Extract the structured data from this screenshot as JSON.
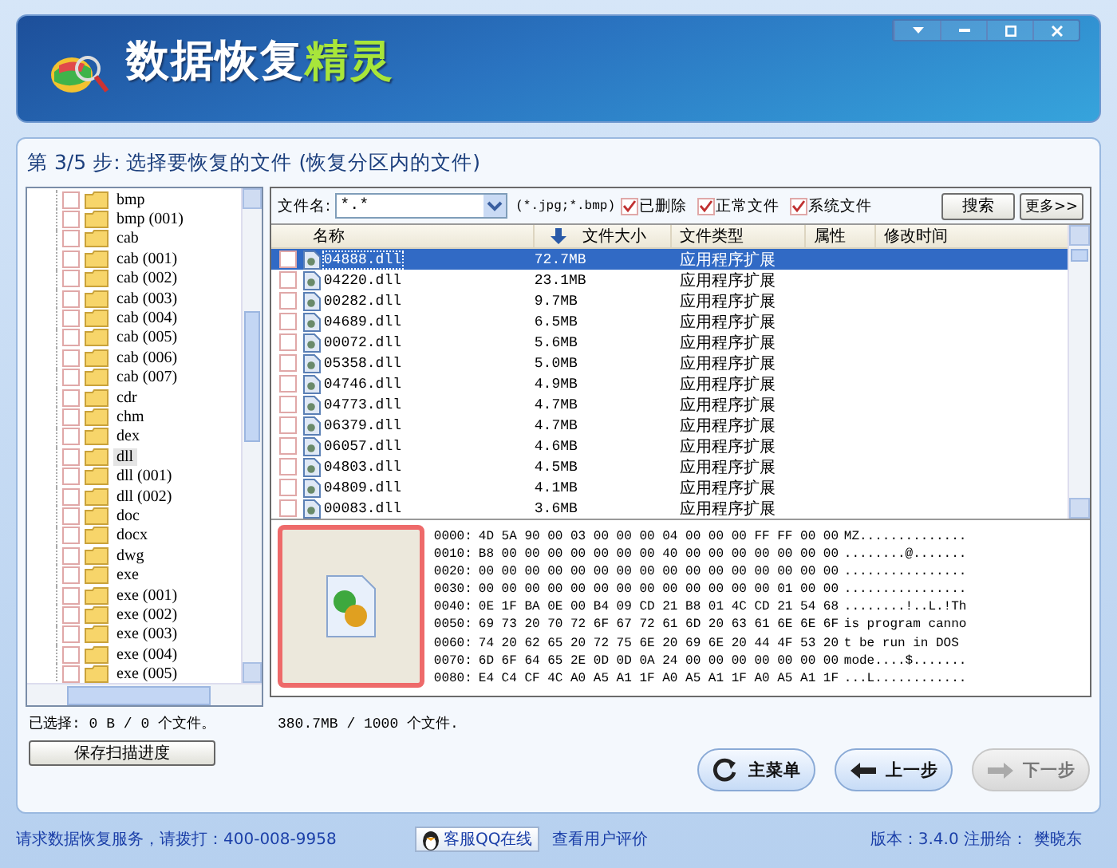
{
  "window": {
    "title_parts": [
      {
        "text": "数据恢复",
        "kind": "plain"
      },
      {
        "text": "精灵",
        "kind": "accent"
      }
    ]
  },
  "step_title": "第 3/5 步: 选择要恢复的文件 (恢复分区内的文件)",
  "tree": {
    "items": [
      {
        "label": "bmp",
        "checked": false,
        "selected": false
      },
      {
        "label": "bmp (001)",
        "checked": false,
        "selected": false
      },
      {
        "label": "cab",
        "checked": false,
        "selected": false
      },
      {
        "label": "cab (001)",
        "checked": false,
        "selected": false
      },
      {
        "label": "cab (002)",
        "checked": false,
        "selected": false
      },
      {
        "label": "cab (003)",
        "checked": false,
        "selected": false
      },
      {
        "label": "cab (004)",
        "checked": false,
        "selected": false
      },
      {
        "label": "cab (005)",
        "checked": false,
        "selected": false
      },
      {
        "label": "cab (006)",
        "checked": false,
        "selected": false
      },
      {
        "label": "cab (007)",
        "checked": false,
        "selected": false
      },
      {
        "label": "cdr",
        "checked": false,
        "selected": false
      },
      {
        "label": "chm",
        "checked": false,
        "selected": false
      },
      {
        "label": "dex",
        "checked": false,
        "selected": false
      },
      {
        "label": "dll",
        "checked": false,
        "selected": true
      },
      {
        "label": "dll (001)",
        "checked": false,
        "selected": false
      },
      {
        "label": "dll (002)",
        "checked": false,
        "selected": false
      },
      {
        "label": "doc",
        "checked": false,
        "selected": false
      },
      {
        "label": "docx",
        "checked": false,
        "selected": false
      },
      {
        "label": "dwg",
        "checked": false,
        "selected": false
      },
      {
        "label": "exe",
        "checked": false,
        "selected": false
      },
      {
        "label": "exe (001)",
        "checked": false,
        "selected": false
      },
      {
        "label": "exe (002)",
        "checked": false,
        "selected": false
      },
      {
        "label": "exe (003)",
        "checked": false,
        "selected": false
      },
      {
        "label": "exe (004)",
        "checked": false,
        "selected": false
      },
      {
        "label": "exe (005)",
        "checked": false,
        "selected": false
      }
    ]
  },
  "filter": {
    "label": "文件名:",
    "value": "*.*",
    "hint": "(*.jpg;*.bmp)",
    "options": [
      {
        "label": "已删除",
        "checked": true
      },
      {
        "label": "正常文件",
        "checked": true
      },
      {
        "label": "系统文件",
        "checked": true
      }
    ],
    "buttons": [
      "搜索",
      "更多>>"
    ]
  },
  "table": {
    "columns": [
      {
        "label": "名称",
        "sorted": false
      },
      {
        "label": "文件大小",
        "sorted": true
      },
      {
        "label": "文件类型",
        "sorted": false
      },
      {
        "label": "属性",
        "sorted": false
      },
      {
        "label": "修改时间",
        "sorted": false
      }
    ],
    "rows": [
      {
        "name": "04888.dll",
        "size": "72.7MB",
        "type": "应用程序扩展",
        "checked": false,
        "selected": true
      },
      {
        "name": "04220.dll",
        "size": "23.1MB",
        "type": "应用程序扩展",
        "checked": false,
        "selected": false
      },
      {
        "name": "00282.dll",
        "size": "9.7MB",
        "type": "应用程序扩展",
        "checked": false,
        "selected": false
      },
      {
        "name": "04689.dll",
        "size": "6.5MB",
        "type": "应用程序扩展",
        "checked": false,
        "selected": false
      },
      {
        "name": "00072.dll",
        "size": "5.6MB",
        "type": "应用程序扩展",
        "checked": false,
        "selected": false
      },
      {
        "name": "05358.dll",
        "size": "5.0MB",
        "type": "应用程序扩展",
        "checked": false,
        "selected": false
      },
      {
        "name": "04746.dll",
        "size": "4.9MB",
        "type": "应用程序扩展",
        "checked": false,
        "selected": false
      },
      {
        "name": "04773.dll",
        "size": "4.7MB",
        "type": "应用程序扩展",
        "checked": false,
        "selected": false
      },
      {
        "name": "06379.dll",
        "size": "4.7MB",
        "type": "应用程序扩展",
        "checked": false,
        "selected": false
      },
      {
        "name": "06057.dll",
        "size": "4.6MB",
        "type": "应用程序扩展",
        "checked": false,
        "selected": false
      },
      {
        "name": "04803.dll",
        "size": "4.5MB",
        "type": "应用程序扩展",
        "checked": false,
        "selected": false
      },
      {
        "name": "04809.dll",
        "size": "4.1MB",
        "type": "应用程序扩展",
        "checked": false,
        "selected": false
      },
      {
        "name": "00083.dll",
        "size": "3.6MB",
        "type": "应用程序扩展",
        "checked": false,
        "selected": false
      }
    ]
  },
  "preview": {
    "hex_rows": [
      {
        "offset": "0000:",
        "hex": "4D 5A 90 00 03 00 00 00 04 00 00 00 FF FF 00 00",
        "ascii": "MZ.............."
      },
      {
        "offset": "0010:",
        "hex": "B8 00 00 00 00 00 00 00 40 00 00 00 00 00 00 00",
        "ascii": "........@......."
      },
      {
        "offset": "0020:",
        "hex": "00 00 00 00 00 00 00 00 00 00 00 00 00 00 00 00",
        "ascii": "................"
      },
      {
        "offset": "0030:",
        "hex": "00 00 00 00 00 00 00 00 00 00 00 00 00 01 00 00",
        "ascii": "................"
      },
      {
        "offset": "0040:",
        "hex": "0E 1F BA 0E 00 B4 09 CD 21 B8 01 4C CD 21 54 68",
        "ascii": "........!..L.!Th"
      },
      {
        "offset": "0050:",
        "hex": "69 73 20 70 72 6F 67 72 61 6D 20 63 61 6E 6E 6F",
        "ascii": "is program canno"
      },
      {
        "offset": "0060:",
        "hex": "74 20 62 65 20 72 75 6E 20 69 6E 20 44 4F 53 20",
        "ascii": "t be run in DOS"
      },
      {
        "offset": "0070:",
        "hex": "6D 6F 64 65 2E 0D 0D 0A 24 00 00 00 00 00 00 00",
        "ascii": "mode....$......."
      },
      {
        "offset": "0080:",
        "hex": "E4 C4 CF 4C A0 A5 A1 1F A0 A5 A1 1F A0 A5 A1 1F",
        "ascii": "...L............"
      }
    ]
  },
  "selected_summary": "已选择: 0 B / 0 个文件。",
  "total_summary": "380.7MB / 1000 个文件.",
  "save_button": "保存扫描进度",
  "nav_buttons": [
    {
      "label": "主菜单",
      "kind": "menu",
      "disabled": false
    },
    {
      "label": "上一步",
      "kind": "back",
      "disabled": false
    },
    {
      "label": "下一步",
      "kind": "next",
      "disabled": true
    }
  ],
  "footer": {
    "service": "请求数据恢复服务，请拨打：400-008-9958",
    "qq": "客服QQ在线",
    "reviews": "查看用户评价",
    "version": "版本：3.4.0 注册给：",
    "owner": "樊晓东"
  }
}
